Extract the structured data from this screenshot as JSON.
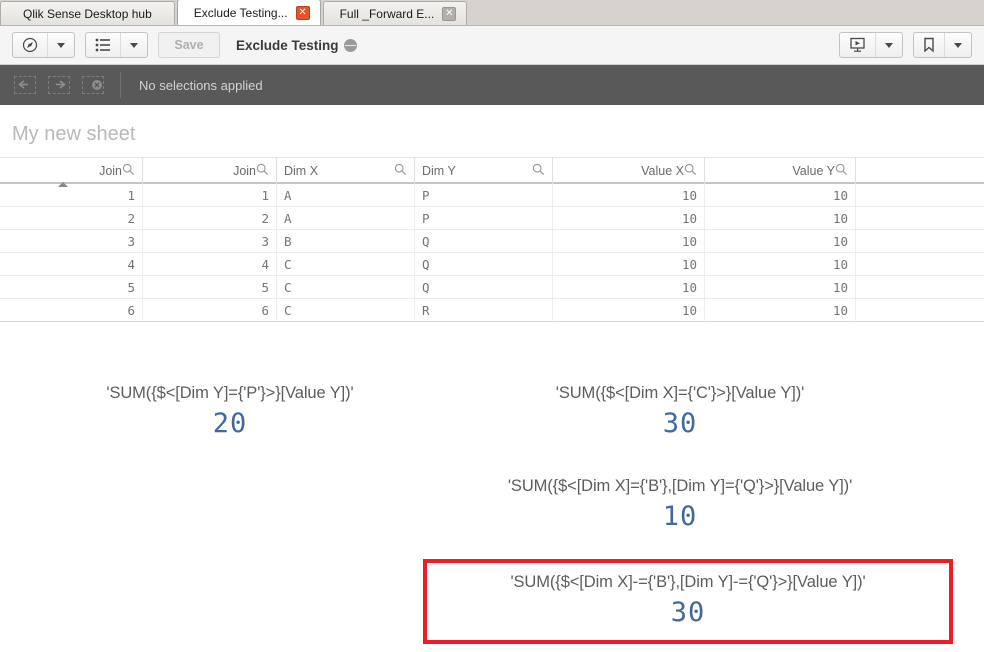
{
  "tabs": [
    {
      "label": "Qlik Sense Desktop hub",
      "active": false,
      "has_close": false,
      "close_state": ""
    },
    {
      "label": "Exclude Testing...",
      "active": true,
      "has_close": true,
      "close_state": "on"
    },
    {
      "label": "Full _Forward E...",
      "active": false,
      "has_close": true,
      "close_state": "off"
    }
  ],
  "toolbar": {
    "nav_icon": "compass-icon",
    "nav_caret": "chevron-down-icon",
    "sheets_icon": "list-icon",
    "sheets_caret": "chevron-down-icon",
    "save_label": "Save",
    "app_title": "Exclude Testing",
    "app_title_icon": "globe-icon",
    "present_icon": "presentation-icon",
    "present_caret": "chevron-down-icon",
    "bookmark_icon": "bookmark-icon",
    "bookmark_caret": "chevron-down-icon"
  },
  "selection_bar": {
    "back_icon": "selection-back-icon",
    "forward_icon": "selection-forward-icon",
    "clear_icon": "clear-selections-icon",
    "status_text": "No selections applied"
  },
  "sheet": {
    "title": "My new sheet"
  },
  "table": {
    "columns": [
      {
        "label": "Join",
        "align": "num",
        "search_icon": "search-icon",
        "sorted": true
      },
      {
        "label": "Join",
        "align": "num",
        "search_icon": "search-icon",
        "sorted": false
      },
      {
        "label": "Dim X",
        "align": "txt",
        "search_icon": "search-icon",
        "sorted": false
      },
      {
        "label": "Dim Y",
        "align": "txt",
        "search_icon": "search-icon",
        "sorted": false
      },
      {
        "label": "Value X",
        "align": "num",
        "search_icon": "search-icon",
        "sorted": false
      },
      {
        "label": "Value Y",
        "align": "num",
        "search_icon": "search-icon",
        "sorted": false
      },
      {
        "label": "",
        "align": "txt",
        "search_icon": "",
        "sorted": false
      }
    ],
    "rows": [
      [
        "1",
        "1",
        "A",
        "P",
        "10",
        "10",
        ""
      ],
      [
        "2",
        "2",
        "A",
        "P",
        "10",
        "10",
        ""
      ],
      [
        "3",
        "3",
        "B",
        "Q",
        "10",
        "10",
        ""
      ],
      [
        "4",
        "4",
        "C",
        "Q",
        "10",
        "10",
        ""
      ],
      [
        "5",
        "5",
        "C",
        "Q",
        "10",
        "10",
        ""
      ],
      [
        "6",
        "6",
        "C",
        "R",
        "10",
        "10",
        ""
      ]
    ]
  },
  "kpis": [
    {
      "expression": "'SUM({$<[Dim Y]={'P'}>}[Value Y])'",
      "value": "20",
      "highlighted": false
    },
    {
      "expression": "'SUM({$<[Dim X]={'C'}>}[Value Y])'",
      "value": "30",
      "highlighted": false
    },
    {
      "expression": "'SUM({$<[Dim X]={'B'},[Dim Y]={'Q'}>}[Value Y])'",
      "value": "10",
      "highlighted": false
    },
    {
      "expression": "'SUM({$<[Dim X]-={'B'},[Dim Y]-={'Q'}>}[Value Y])'",
      "value": "30",
      "highlighted": true
    }
  ],
  "colors": {
    "kpi_value": "#41699a",
    "highlight_border": "#ee1d23",
    "selection_bar": "#595959",
    "active_tab_close": "#e0552a"
  }
}
